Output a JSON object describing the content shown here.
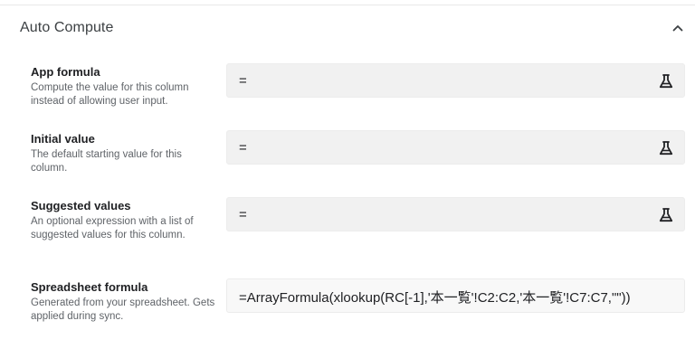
{
  "section": {
    "title": "Auto Compute",
    "collapse_icon": "chevron-up-icon"
  },
  "fields": [
    {
      "title": "App formula",
      "description": "Compute the value for this column instead of allowing user input.",
      "value": "=",
      "icon": "flask-icon"
    },
    {
      "title": "Initial value",
      "description": "The default starting value for this column.",
      "value": "=",
      "icon": "flask-icon"
    },
    {
      "title": "Suggested values",
      "description": "An optional expression with a list of suggested values for this column.",
      "value": "=",
      "icon": "flask-icon"
    }
  ],
  "spreadsheet_formula": {
    "title": "Spreadsheet formula",
    "description": "Generated from your spreadsheet. Gets applied during sync.",
    "value": "=ArrayFormula(xlookup(RC[-1],'本一覧'!C2:C2,'本一覧'!C7:C7,\"\"))"
  }
}
